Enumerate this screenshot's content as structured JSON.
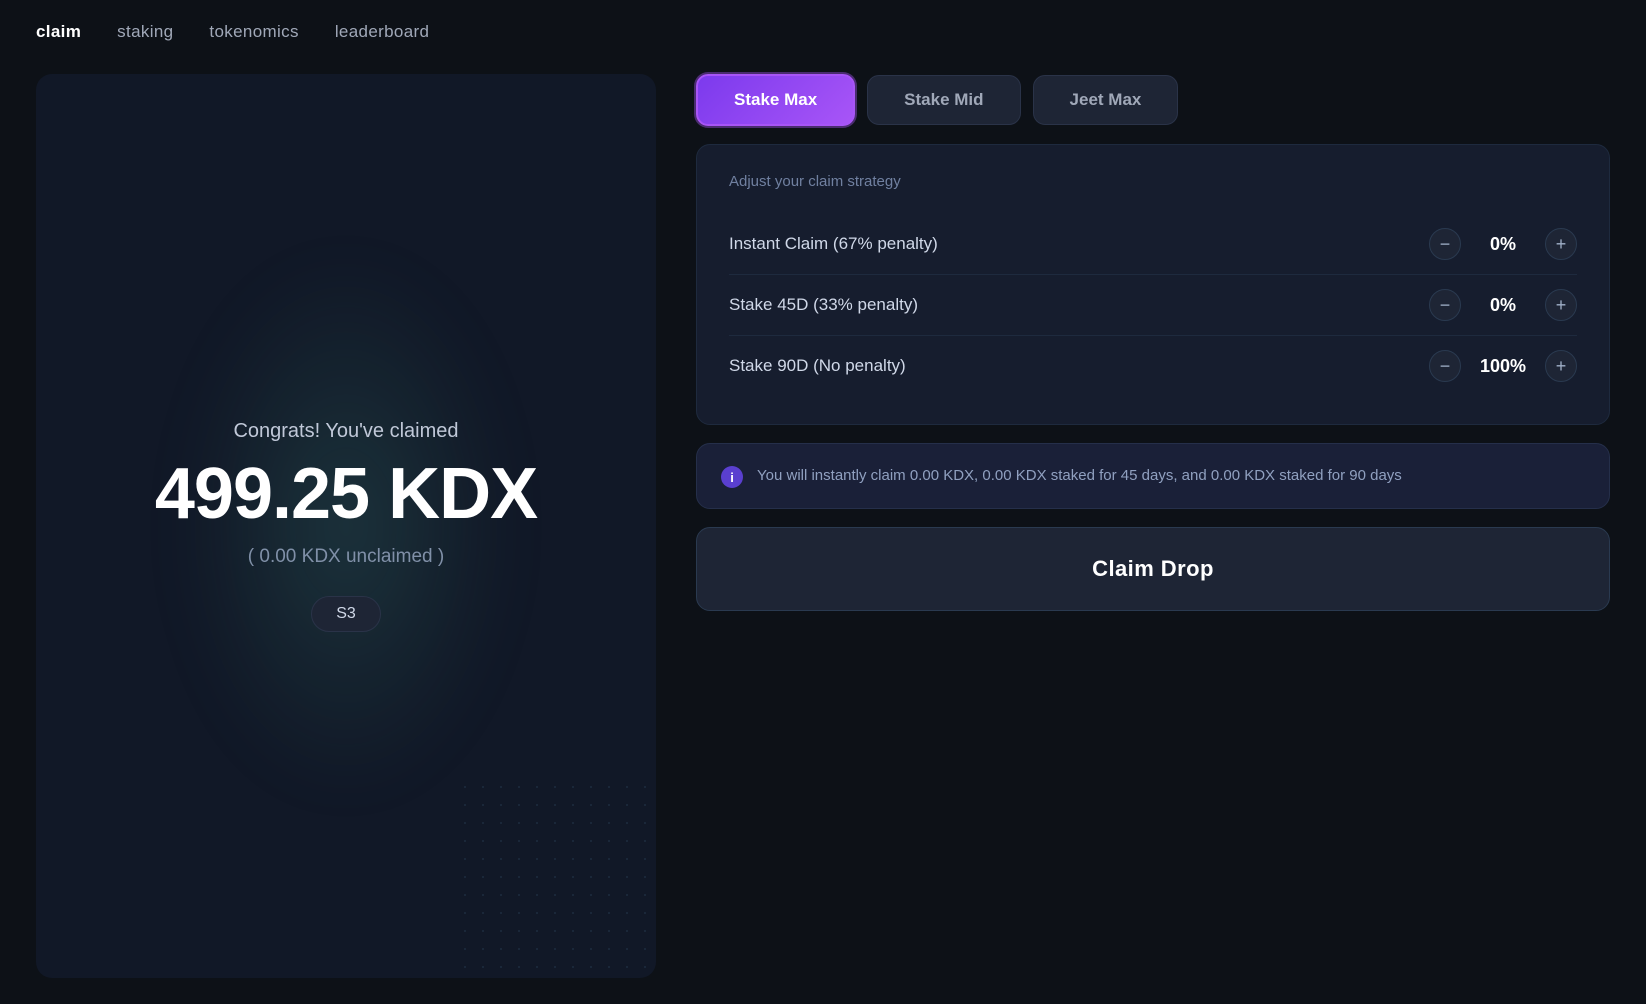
{
  "nav": {
    "items": [
      {
        "label": "claim",
        "active": true
      },
      {
        "label": "staking",
        "active": false
      },
      {
        "label": "tokenomics",
        "active": false
      },
      {
        "label": "leaderboard",
        "active": false
      }
    ]
  },
  "left_card": {
    "congrats_text": "Congrats! You've claimed",
    "amount": "499.25 KDX",
    "unclaimed": "( 0.00 KDX unclaimed )",
    "season_badge": "S3"
  },
  "tabs": [
    {
      "label": "Stake Max",
      "active": true
    },
    {
      "label": "Stake Mid",
      "active": false
    },
    {
      "label": "Jeet Max",
      "active": false
    }
  ],
  "strategy_panel": {
    "header": "Adjust your claim strategy",
    "rows": [
      {
        "label": "Instant Claim (67% penalty)",
        "value": "0%"
      },
      {
        "label": "Stake 45D (33% penalty)",
        "value": "0%"
      },
      {
        "label": "Stake 90D (No penalty)",
        "value": "100%"
      }
    ]
  },
  "info_box": {
    "icon": "i",
    "text": "You will instantly claim 0.00 KDX, 0.00 KDX staked for 45 days, and 0.00 KDX staked for 90 days"
  },
  "claim_button": {
    "label": "Claim Drop"
  },
  "icons": {
    "minus": "−",
    "plus": "+"
  }
}
